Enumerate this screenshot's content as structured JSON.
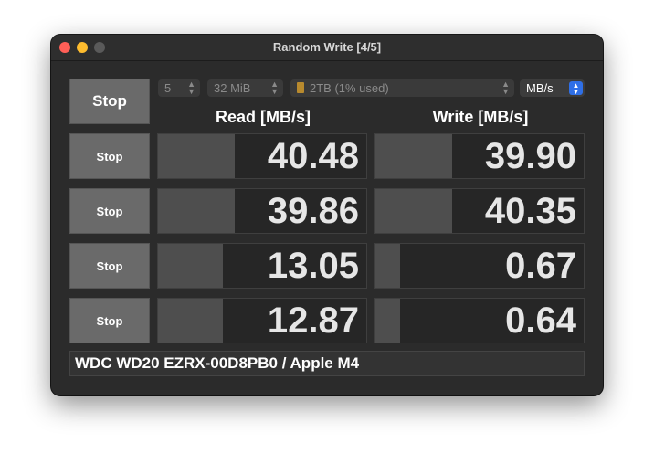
{
  "window": {
    "title": "Random Write [4/5]"
  },
  "controls": {
    "all_button_label": "Stop",
    "count": "5",
    "size": "32 MiB",
    "drive": "2TB (1% used)",
    "units": "MB/s"
  },
  "headers": {
    "read": "Read [MB/s]",
    "write": "Write [MB/s]"
  },
  "rows": [
    {
      "button": "Stop",
      "read": "40.48",
      "write": "39.90",
      "read_fill": 0.37,
      "write_fill": 0.37
    },
    {
      "button": "Stop",
      "read": "39.86",
      "write": "40.35",
      "read_fill": 0.37,
      "write_fill": 0.37
    },
    {
      "button": "Stop",
      "read": "13.05",
      "write": "0.67",
      "read_fill": 0.31,
      "write_fill": 0.12
    },
    {
      "button": "Stop",
      "read": "12.87",
      "write": "0.64",
      "read_fill": 0.31,
      "write_fill": 0.12
    }
  ],
  "footer": {
    "device": "WDC WD20 EZRX-00D8PB0 / Apple M4"
  },
  "colors": {
    "bar": "#4e4e4e",
    "units_accent": "#2f6fe6",
    "close": "#ff5f57",
    "minimize": "#febc2e"
  }
}
